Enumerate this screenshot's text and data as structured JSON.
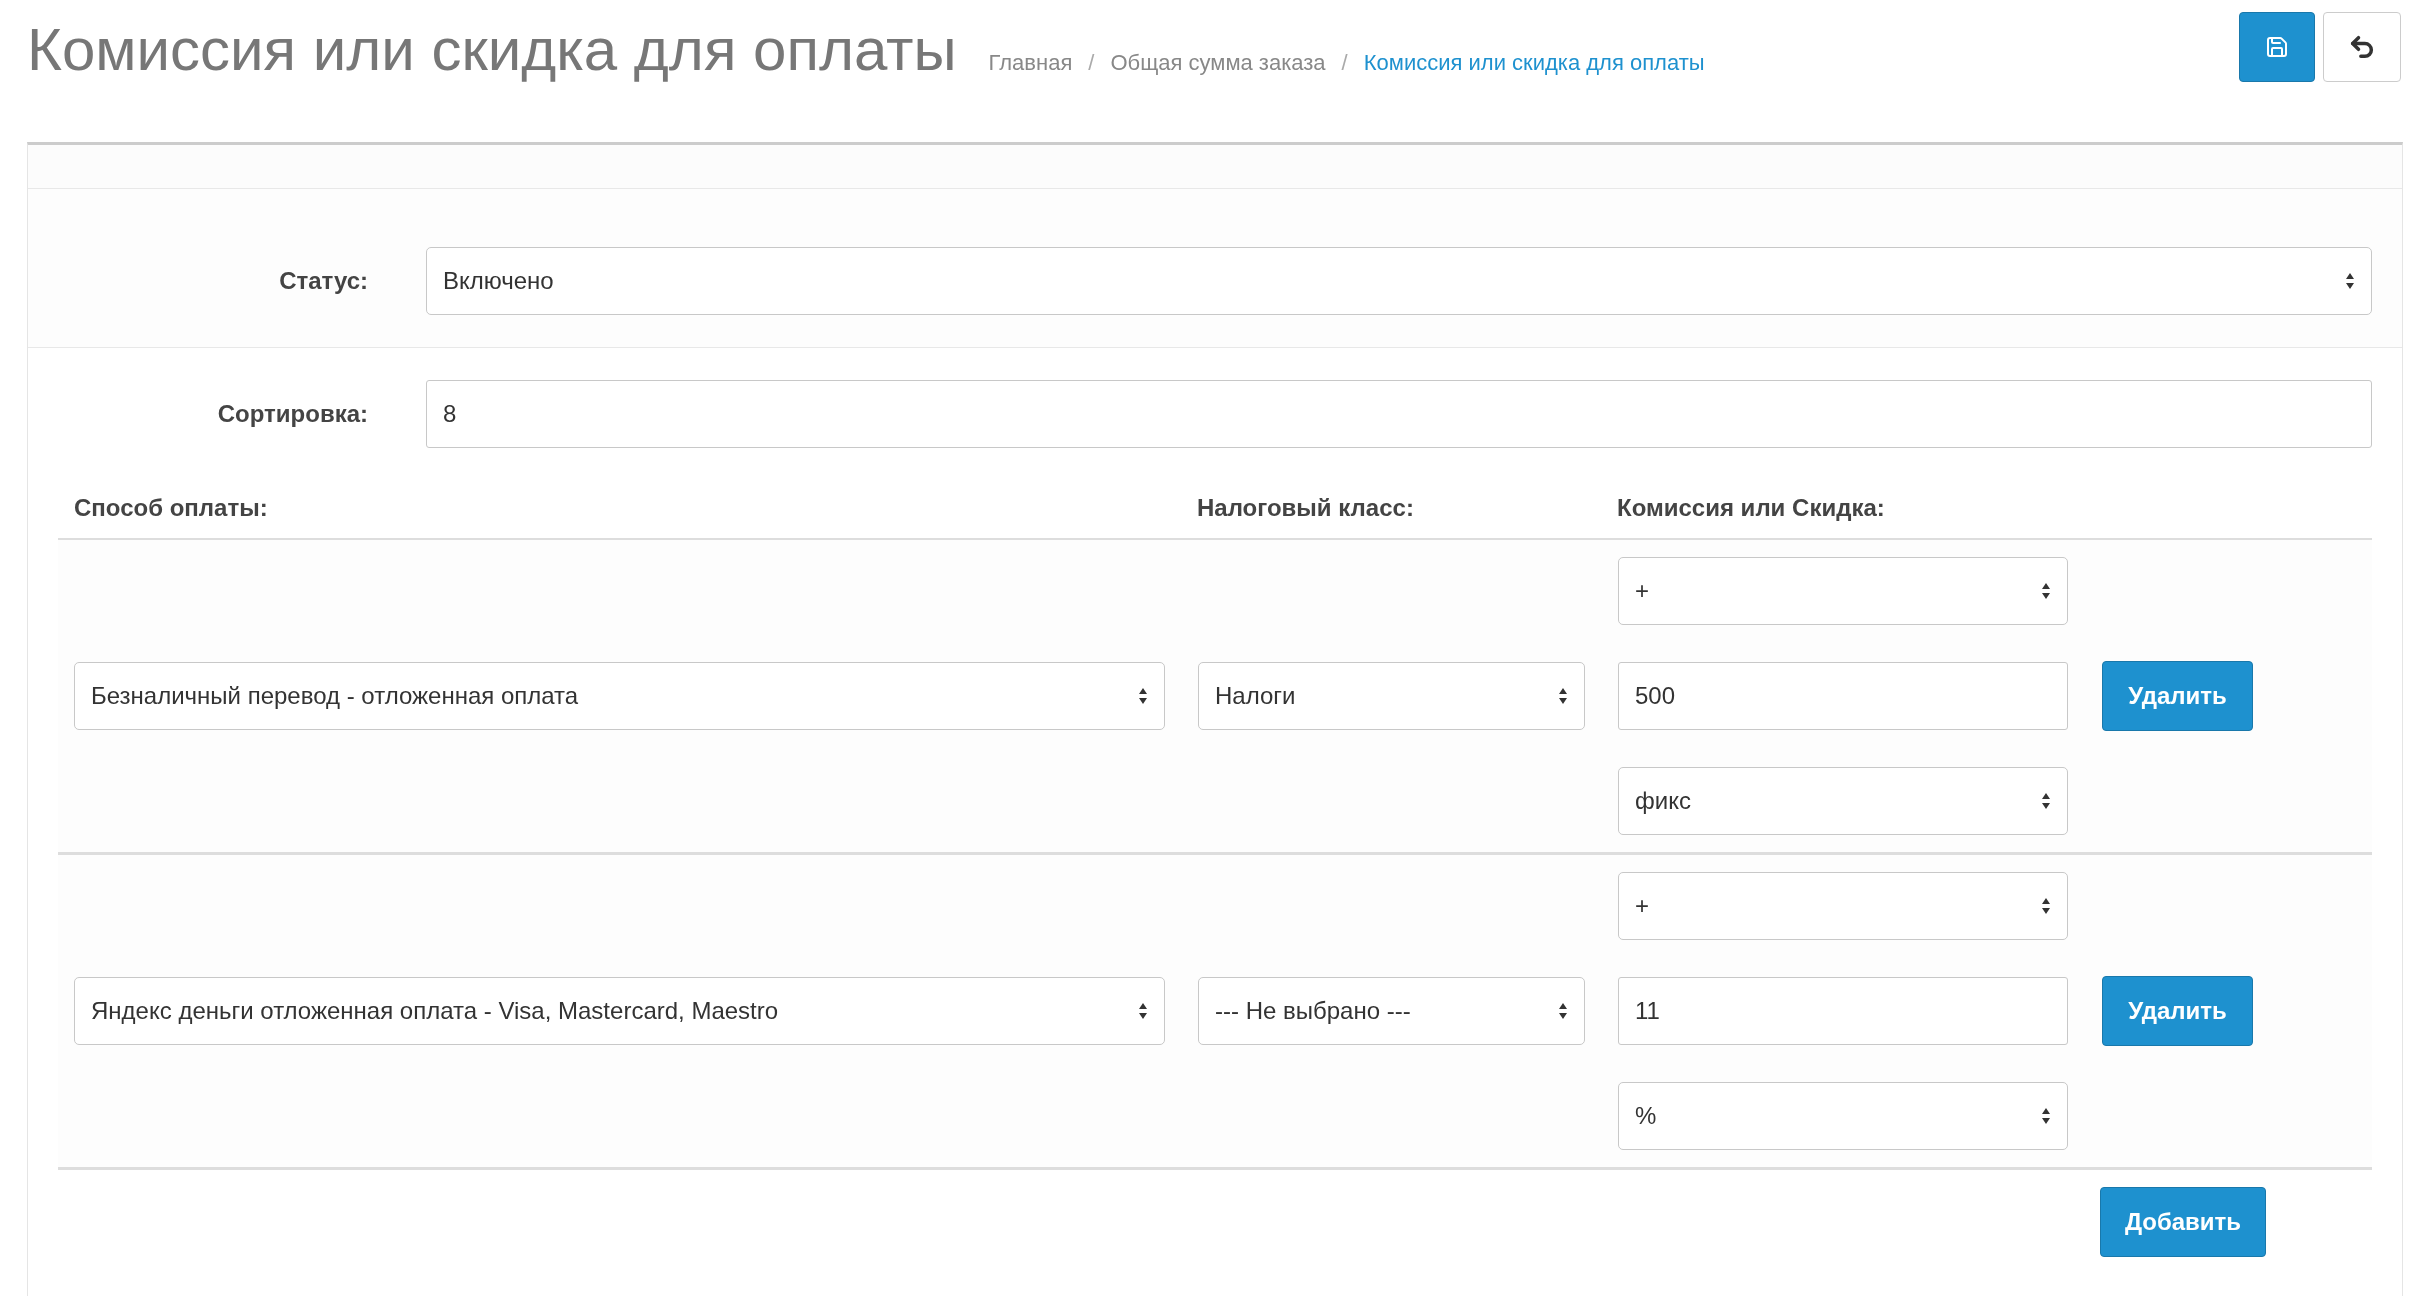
{
  "title": "Комиссия или скидка для оплаты",
  "breadcrumbs": [
    {
      "label": "Главная",
      "current": false
    },
    {
      "separator": "/",
      "label": "Общая сумма заказа",
      "current": false
    },
    {
      "separator": "/",
      "label": "Комиссия или скидка для оплаты",
      "current": true
    }
  ],
  "status": {
    "label": "Статус:",
    "value": "Включено"
  },
  "sort_order": {
    "label": "Сортировка:",
    "value": "8"
  },
  "columns": [
    "Способ оплаты:",
    "Налоговый класс:",
    "Комиссия или Скидка:"
  ],
  "rows": [
    {
      "payment": "Безналичный перевод - отложенная оплата",
      "tax": "Налоги",
      "sign": "+",
      "amount": "500",
      "type": "фикс",
      "remove": "Удалить"
    },
    {
      "payment": "Яндекс деньги отложенная оплата - Visa, Mastercard, Maestro",
      "tax": "--- Не выбрано ---",
      "sign": "+",
      "amount": "11",
      "type": "%",
      "remove": "Удалить"
    }
  ],
  "add_button": "Добавить"
}
